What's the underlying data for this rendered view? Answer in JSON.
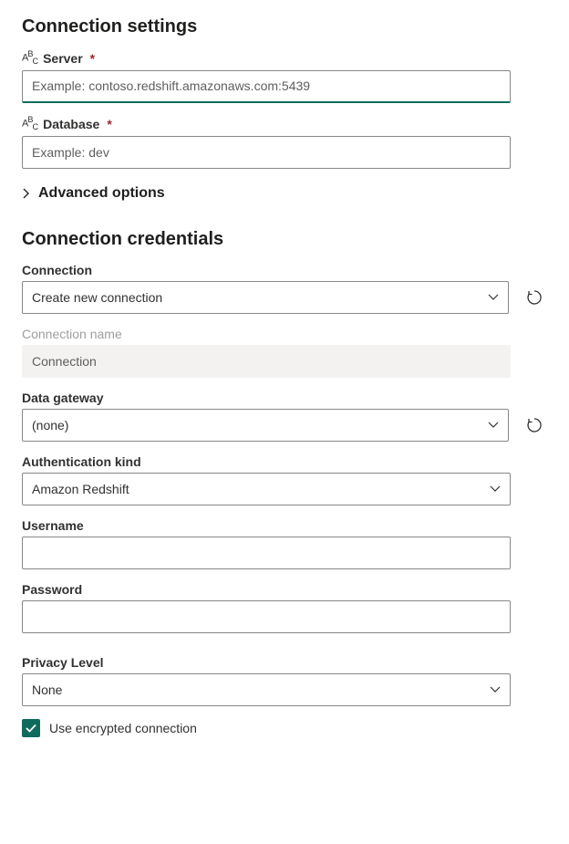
{
  "settings": {
    "heading": "Connection settings",
    "server_label": "Server",
    "server_placeholder": "Example: contoso.redshift.amazonaws.com:5439",
    "database_label": "Database",
    "database_placeholder": "Example: dev",
    "advanced_label": "Advanced options"
  },
  "credentials": {
    "heading": "Connection credentials",
    "connection_label": "Connection",
    "connection_value": "Create new connection",
    "connection_name_label": "Connection name",
    "connection_name_placeholder": "Connection",
    "gateway_label": "Data gateway",
    "gateway_value": "(none)",
    "auth_label": "Authentication kind",
    "auth_value": "Amazon Redshift",
    "username_label": "Username",
    "password_label": "Password",
    "privacy_label": "Privacy Level",
    "privacy_value": "None",
    "encrypted_label": "Use encrypted connection"
  }
}
